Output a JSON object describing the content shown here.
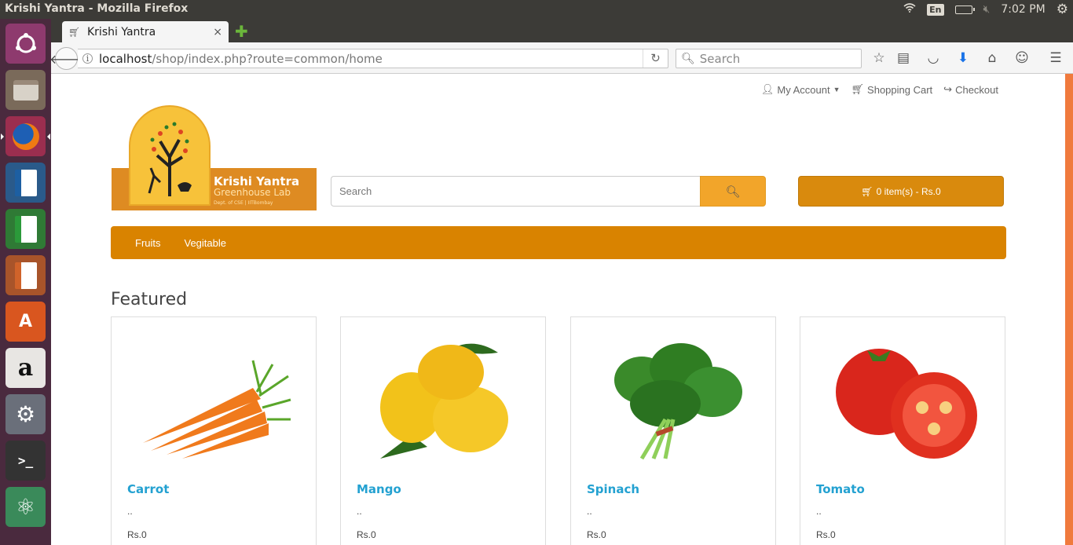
{
  "os": {
    "window_title": "Krishi Yantra - Mozilla Firefox",
    "lang": "En",
    "time": "7:02 PM"
  },
  "launcher": {
    "items": [
      "ubuntu-icon",
      "files-icon",
      "firefox-icon",
      "writer-icon",
      "calc-icon",
      "impress-icon",
      "software-center-icon",
      "amazon-icon",
      "settings-icon",
      "terminal-icon",
      "atom-icon"
    ]
  },
  "browser": {
    "tab_title": "Krishi Yantra",
    "tab_close": "×",
    "new_tab": "✚",
    "url_host": "localhost",
    "url_path": "/shop/index.php?route=common/home",
    "search_placeholder": "Search"
  },
  "page": {
    "toplinks": {
      "account": "My Account",
      "cart": "Shopping Cart",
      "checkout": "Checkout"
    },
    "logo": {
      "title": "Krishi Yantra",
      "subtitle": "Greenhouse Lab",
      "dept": "Dept. of CSE | IITBombay"
    },
    "search_placeholder": "Search",
    "cart_button": "0 item(s) - Rs.0",
    "menu": [
      "Fruits",
      "Vegitable"
    ],
    "featured_heading": "Featured",
    "products": [
      {
        "name": "Carrot",
        "desc": "..",
        "price": "Rs.0"
      },
      {
        "name": "Mango",
        "desc": "..",
        "price": "Rs.0"
      },
      {
        "name": "Spinach",
        "desc": "..",
        "price": "Rs.0"
      },
      {
        "name": "Tomato",
        "desc": "..",
        "price": "Rs.0"
      }
    ]
  },
  "colors": {
    "brand_orange": "#d98300",
    "search_button": "#f2a52a",
    "link_blue": "#23a1d1",
    "launcher_bg": "#4a2a3e"
  }
}
